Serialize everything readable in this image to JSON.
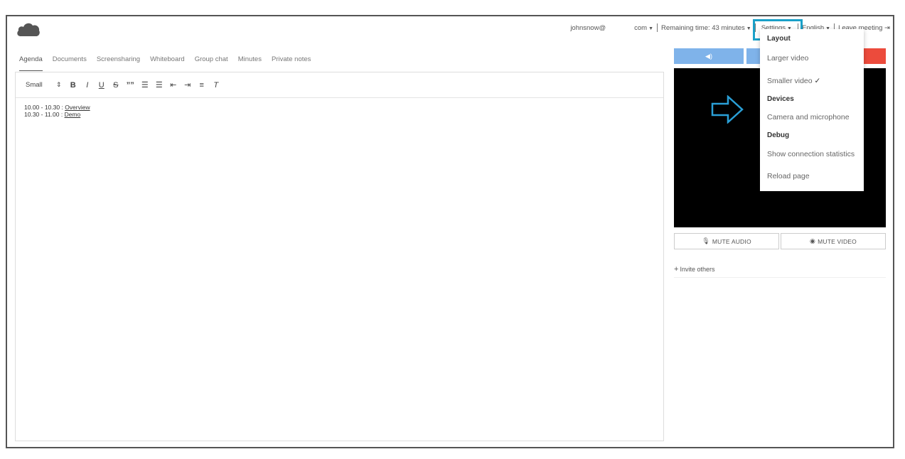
{
  "topbar": {
    "user": "johnsnow@",
    "user_suffix": "com",
    "remaining_time": "Remaining time: 43 minutes",
    "settings": "Settings",
    "language": "English",
    "leave": "Leave meeting"
  },
  "tabs": [
    {
      "label": "Agenda"
    },
    {
      "label": "Documents"
    },
    {
      "label": "Screensharing"
    },
    {
      "label": "Whiteboard"
    },
    {
      "label": "Group chat"
    },
    {
      "label": "Minutes"
    },
    {
      "label": "Private notes"
    }
  ],
  "toolbar": {
    "size": "Small",
    "bold": "B",
    "italic": "I",
    "underline": "U",
    "strike": "S",
    "quote": "””",
    "clear": "T"
  },
  "agenda": [
    {
      "time": "10.00 - 10.30 : ",
      "link": "Overview"
    },
    {
      "time": "10.30 - 11.00 : ",
      "link": "Demo"
    }
  ],
  "video": {
    "mute_audio": "MUTE AUDIO",
    "mute_video": "MUTE VIDEO",
    "invite": "Invite others"
  },
  "settings_menu": {
    "layout_header": "Layout",
    "larger_video": "Larger video",
    "smaller_video": "Smaller video",
    "checkmark": "✓",
    "devices_header": "Devices",
    "camera_mic": "Camera and microphone",
    "debug_header": "Debug",
    "connection_stats": "Show connection statistics",
    "reload": "Reload page"
  },
  "colors": {
    "highlight": "#1aa0c8",
    "control_blue": "#7fb3ea",
    "end_red": "#ec4b3c"
  }
}
